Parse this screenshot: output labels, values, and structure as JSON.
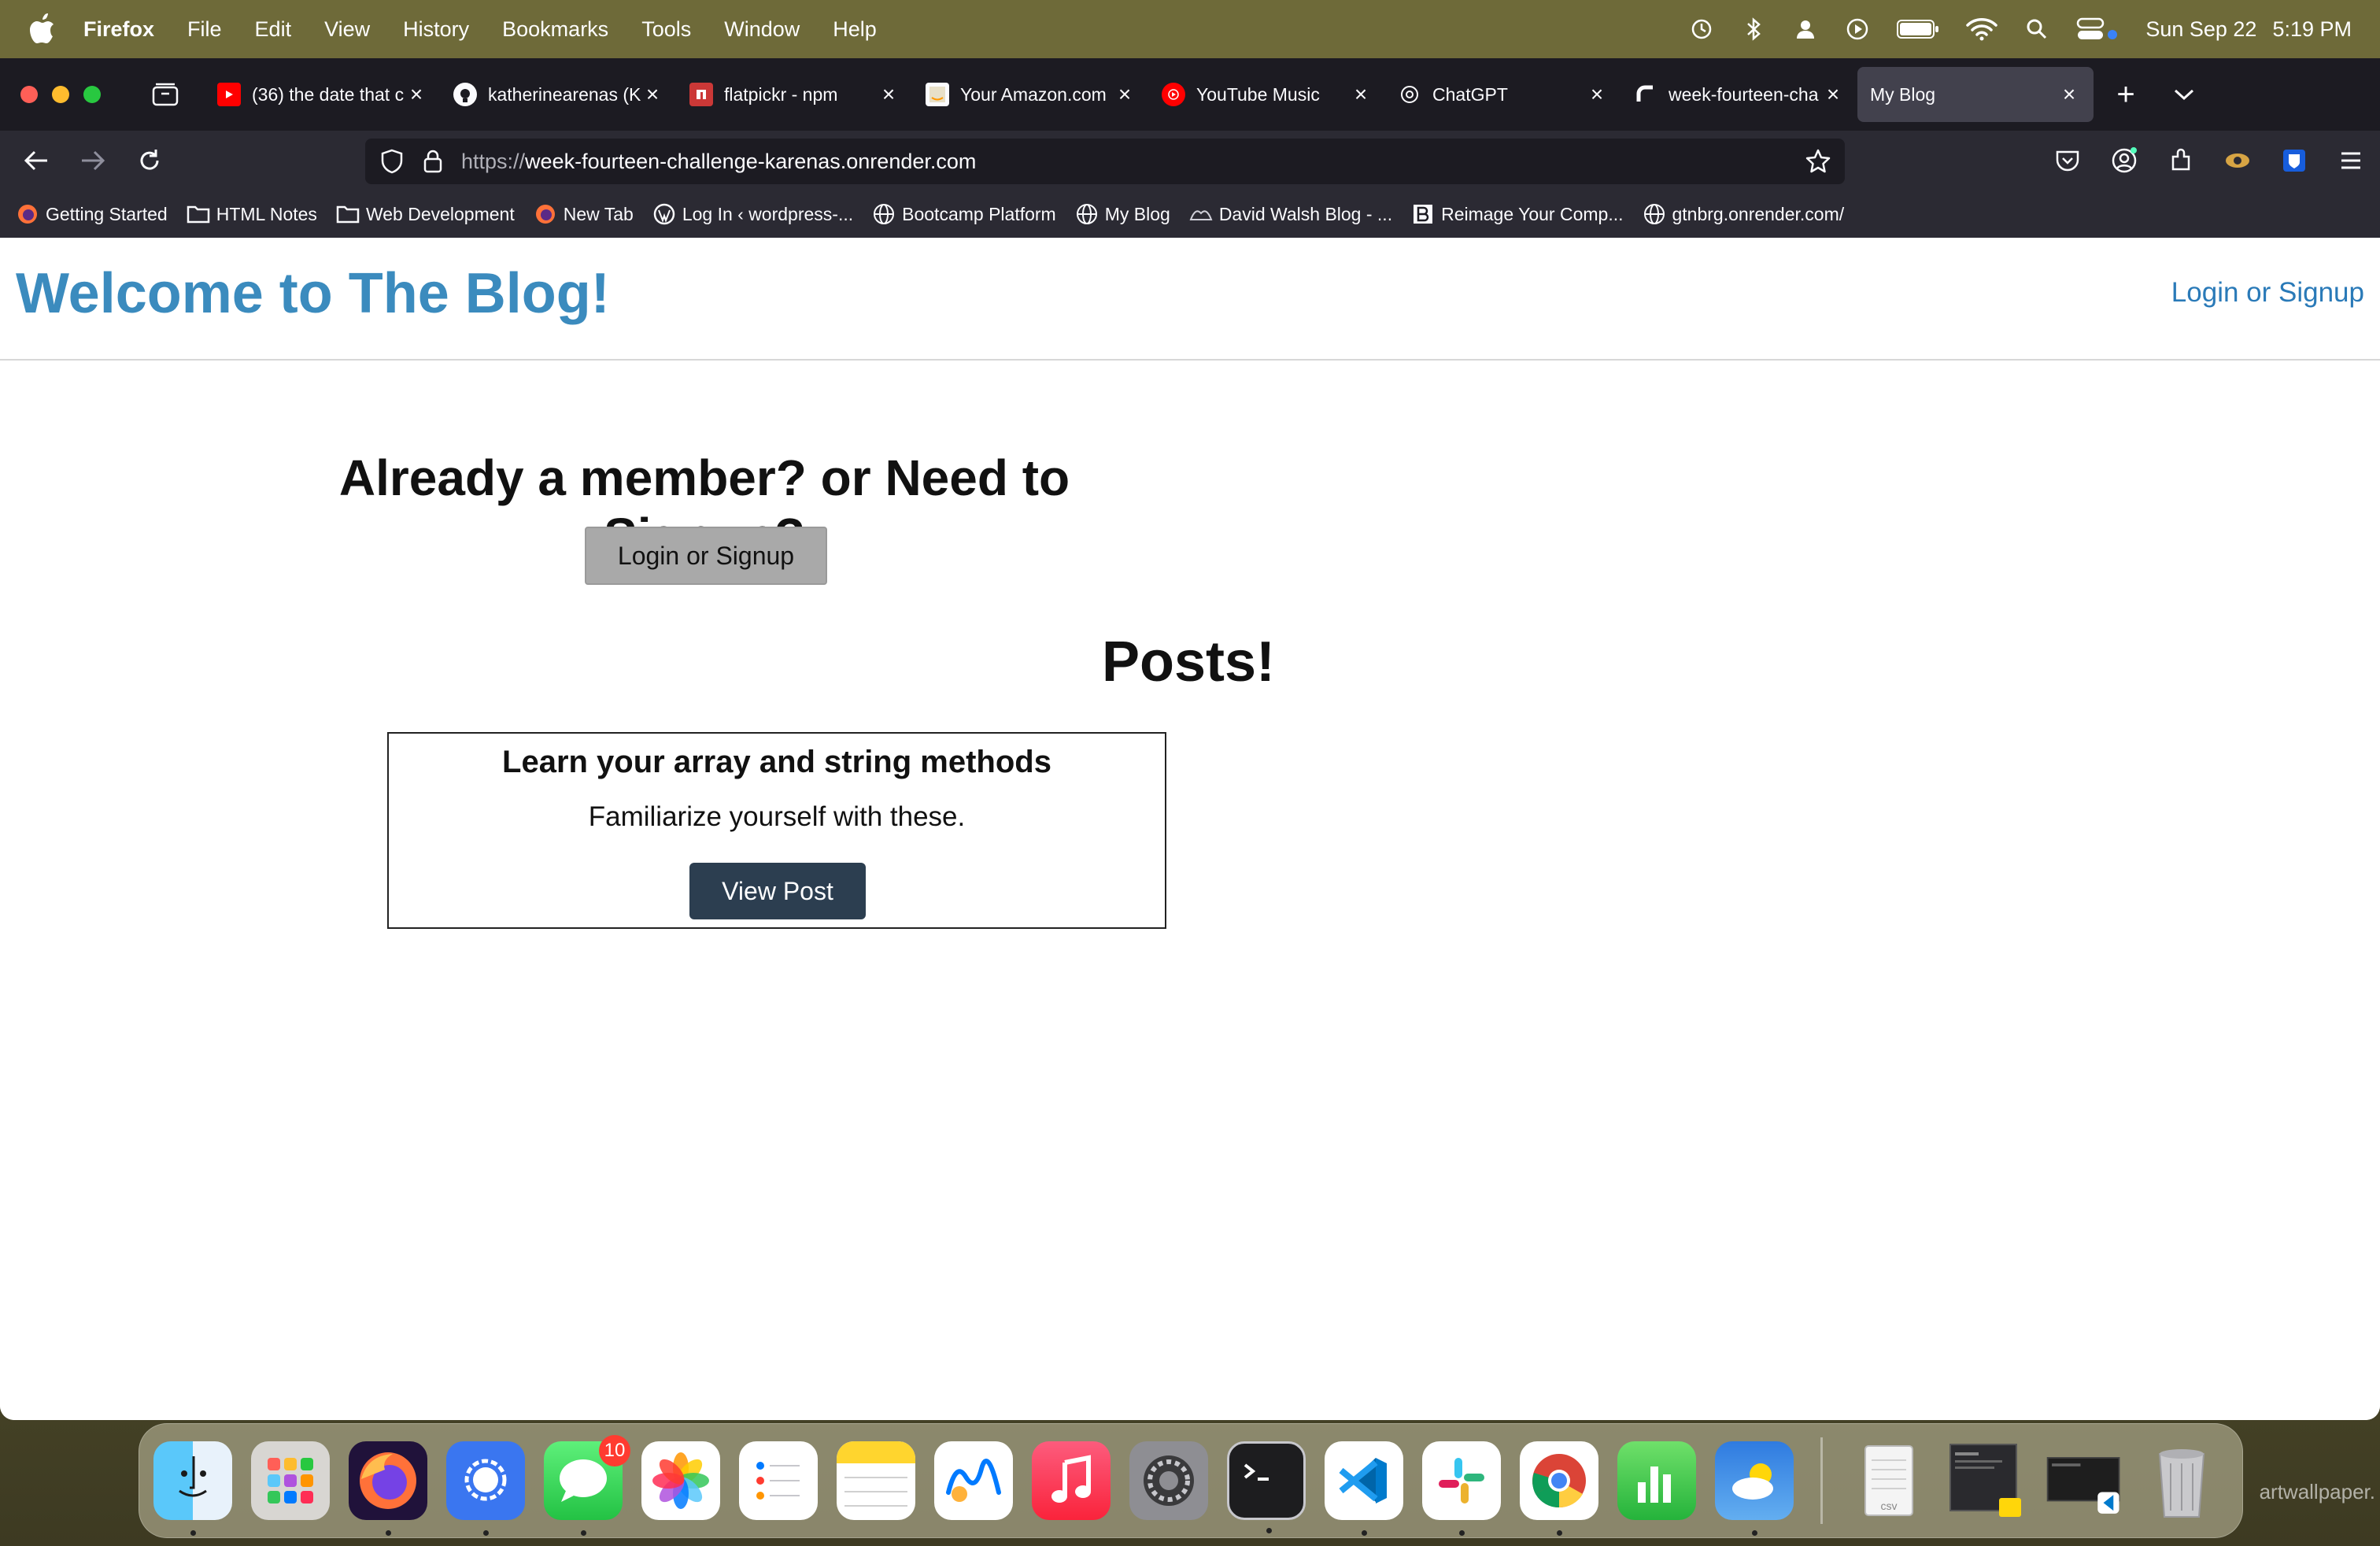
{
  "menubar": {
    "app_name": "Firefox",
    "menus": [
      "File",
      "Edit",
      "View",
      "History",
      "Bookmarks",
      "Tools",
      "Window",
      "Help"
    ],
    "date": "Sun Sep 22",
    "time": "5:19 PM",
    "status_icons": [
      "time-machine-icon",
      "bluetooth-icon",
      "user-icon",
      "play-icon",
      "battery-icon",
      "wifi-icon",
      "spotlight-icon",
      "control-center-icon"
    ]
  },
  "tabs": [
    {
      "title": "(36) the date that c",
      "favicon": "youtube-icon"
    },
    {
      "title": "katherinearenas (K",
      "favicon": "github-icon"
    },
    {
      "title": "flatpickr - npm",
      "favicon": "npm-icon"
    },
    {
      "title": "Your Amazon.com",
      "favicon": "amazon-icon"
    },
    {
      "title": "YouTube Music",
      "favicon": "youtube-music-icon"
    },
    {
      "title": "ChatGPT",
      "favicon": "chatgpt-icon"
    },
    {
      "title": "week-fourteen-cha",
      "favicon": "render-icon"
    },
    {
      "title": "My Blog",
      "favicon": "",
      "active": true
    }
  ],
  "urlbar": {
    "scheme": "https://",
    "host": "week-fourteen-challenge-karenas.onrender.com"
  },
  "bookmarks": [
    {
      "label": "Getting Started",
      "icon": "firefox-icon"
    },
    {
      "label": "HTML Notes",
      "icon": "folder-icon"
    },
    {
      "label": "Web Development",
      "icon": "folder-icon"
    },
    {
      "label": "New Tab",
      "icon": "firefox-icon"
    },
    {
      "label": "Log In ‹ wordpress-...",
      "icon": "wordpress-icon"
    },
    {
      "label": "Bootcamp Platform",
      "icon": "globe-icon"
    },
    {
      "label": "My Blog",
      "icon": "globe-icon"
    },
    {
      "label": "David Walsh Blog - ...",
      "icon": "david-walsh-icon"
    },
    {
      "label": "Reimage Your Comp...",
      "icon": "reimage-icon"
    },
    {
      "label": "gtnbrg.onrender.com/",
      "icon": "globe-icon"
    }
  ],
  "site": {
    "title": "Welcome to The Blog!",
    "login_link": "Login or Signup",
    "member_heading": "Already a member? or Need to Signup?",
    "member_button": "Login or Signup",
    "posts_heading": "Posts!",
    "post": {
      "title": "Learn your array and string methods",
      "description": "Familiarize yourself with these.",
      "button": "View Post"
    }
  },
  "dock": {
    "apps": [
      "finder",
      "launchpad",
      "firefox",
      "signal",
      "messages",
      "photos",
      "reminders",
      "notes",
      "freeform",
      "music",
      "system-settings",
      "terminal",
      "vscode",
      "slack",
      "chrome",
      "numbers",
      "weather"
    ],
    "messages_badge": "10",
    "stack_label": "csv"
  },
  "watermark": "artwallpaper."
}
